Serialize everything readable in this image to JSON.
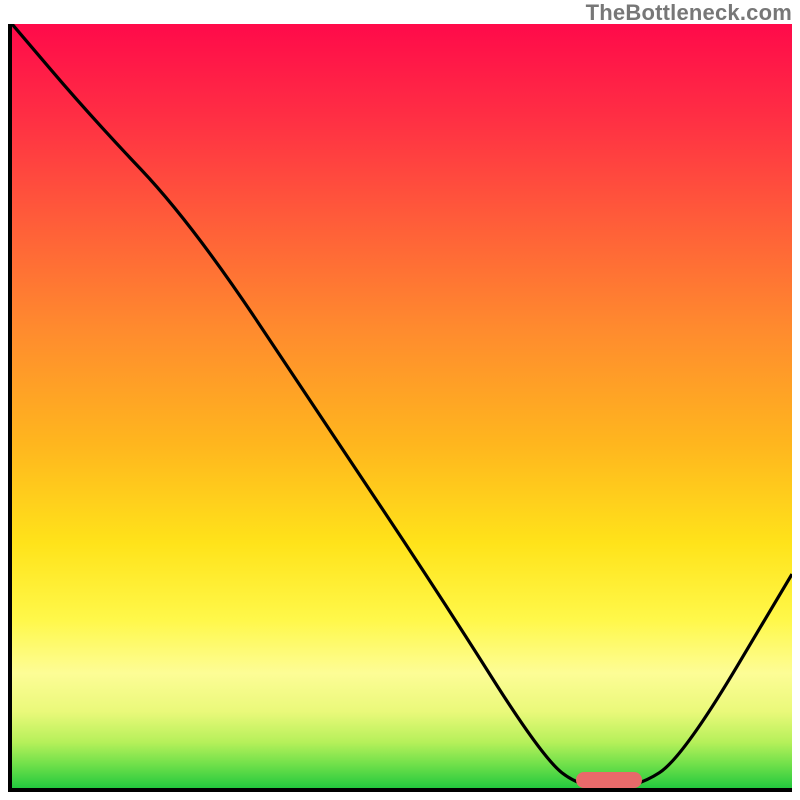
{
  "watermark": "TheBottleneck.com",
  "chart_data": {
    "type": "line",
    "title": "",
    "xlabel": "",
    "ylabel": "",
    "x": [
      0.0,
      0.1,
      0.23,
      0.4,
      0.55,
      0.68,
      0.73,
      0.8,
      0.86,
      1.0
    ],
    "values": [
      1.0,
      0.88,
      0.74,
      0.48,
      0.25,
      0.04,
      0.0,
      0.0,
      0.04,
      0.28
    ],
    "xlim": [
      0,
      1
    ],
    "ylim": [
      0,
      1
    ],
    "marker": {
      "x_center": 0.765,
      "y": 0.0,
      "width": 0.085
    },
    "background": "rainbow-vertical-gradient"
  },
  "colors": {
    "axis": "#000000",
    "curve": "#000000",
    "marker": "#e86a6a",
    "watermark": "#777777"
  }
}
